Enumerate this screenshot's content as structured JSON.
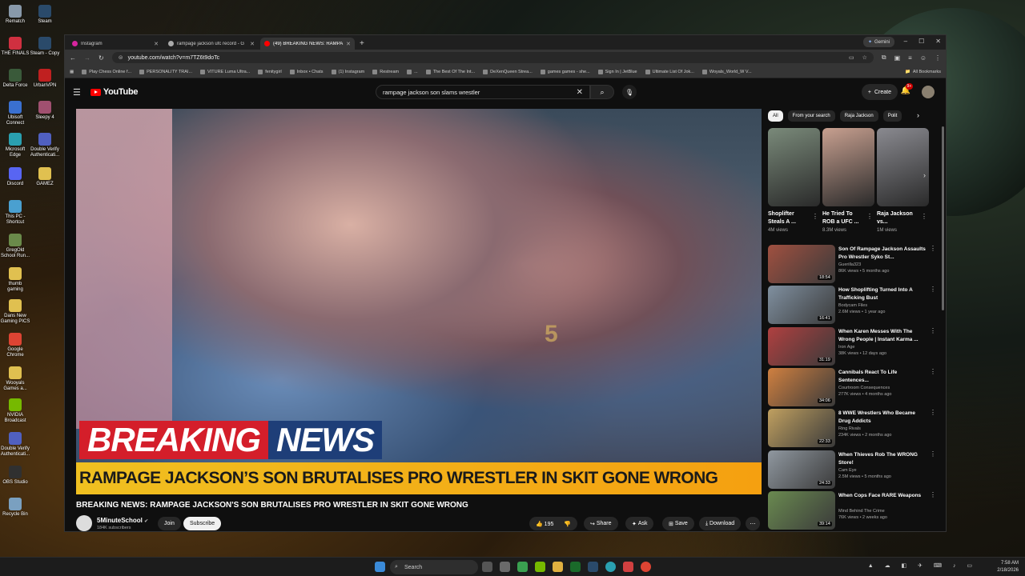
{
  "desktop_icons": [
    {
      "label": "Rematch",
      "color": "#8899aa"
    },
    {
      "label": "Steam",
      "color": "#2a4a6a"
    },
    {
      "label": "THE FINALS",
      "color": "#d03040"
    },
    {
      "label": "Steam - Copy",
      "color": "#2a4a6a"
    },
    {
      "label": "Delta Force",
      "color": "#3a5a3a"
    },
    {
      "label": "UrbanVPN",
      "color": "#c02020"
    },
    {
      "label": "Ubisoft Connect",
      "color": "#3a70d0"
    },
    {
      "label": "Sleepy 4",
      "color": "#a05070"
    },
    {
      "label": "Microsoft Edge",
      "color": "#2aa0b0"
    },
    {
      "label": "Double Verify Authenticati...",
      "color": "#5060c0"
    },
    {
      "label": "Discord",
      "color": "#5865f2"
    },
    {
      "label": "GAMEZ",
      "color": "#e0c050"
    },
    {
      "label": "This PC - Shortcut",
      "color": "#4aa0d0"
    },
    {
      "label": "GregOld School Run...",
      "color": "#6a8a4a"
    },
    {
      "label": "thumb gaming",
      "color": "#e0c050"
    },
    {
      "label": "Dans New Gaming PICS",
      "color": "#e0c050"
    },
    {
      "label": "Google Chrome",
      "color": "#dd4433"
    },
    {
      "label": "Wooyals Games a...",
      "color": "#e0c050"
    },
    {
      "label": "NVIDIA Broadcast",
      "color": "#76b900"
    },
    {
      "label": "Double Verify Authenticati...",
      "color": "#5060c0"
    },
    {
      "label": "OBS Studio",
      "color": "#303030"
    },
    {
      "label": "Recycle Bin",
      "color": "#7aa0c0"
    }
  ],
  "browser": {
    "tabs": [
      {
        "title": "Instagram",
        "color": "#d6249f",
        "active": false
      },
      {
        "title": "rampage jackson ufc record - G",
        "color": "#aaaaaa",
        "active": false
      },
      {
        "title": "(49) BREAKING NEWS: RAMPA",
        "color": "#ff0000",
        "active": true
      }
    ],
    "gemini_label": "Gemini",
    "url": "youtube.com/watch?v=m7TZ6t9doTc",
    "bookmarks": [
      "Play Chess Online f...",
      "PERSONALITY TRAI...",
      "VITURE Luma Ultra...",
      "fenitygirl",
      "Inbox • Chats",
      "(1) Instagram",
      "Restream",
      "...",
      "The Best Of The Int...",
      "DeXenQueen Strea...",
      "games games - she...",
      "Sign In | JetBlue",
      "Ultimate List Of Jok...",
      "Woyals_World_W V..."
    ],
    "all_bookmarks": "All Bookmarks"
  },
  "youtube": {
    "logo_text": "YouTube",
    "search_query": "rampage jackson son slams wrestler",
    "create_label": "Create",
    "notif_count": "9+",
    "video": {
      "breaking_word1": "BREAKING",
      "breaking_word2": "NEWS",
      "ticker": "RAMPAGE JACKSON’S SON BRUTALISES PRO WRESTLER IN SKIT GONE WRONG",
      "title": "BREAKING NEWS: RAMPAGE JACKSON'S SON BRUTALISES PRO WRESTLER IN SKIT GONE WRONG",
      "channel": "5MinuteSchool",
      "subscribers": "184K subscribers",
      "join": "Join",
      "subscribe": "Subscribe",
      "likes": "195",
      "share": "Share",
      "ask": "Ask",
      "save": "Save",
      "download": "Download"
    },
    "chips": [
      "All",
      "From your search",
      "Raja Jackson",
      "Polit"
    ],
    "shorts": [
      {
        "title": "Shoplifter Steals A ...",
        "views": "4M views",
        "color": "#7a8a7a"
      },
      {
        "title": "He Tried To ROB a UFC ...",
        "views": "8.3M views",
        "color": "#c8a090"
      },
      {
        "title": "Raja Jackson vs...",
        "views": "1M views",
        "color": "#8a8a90"
      }
    ],
    "recommendations": [
      {
        "title": "Son Of Rampage Jackson Assaults Pro Wrestler Syko St...",
        "channel": "Guerilla323",
        "meta": "86K views • 5 months ago",
        "duration": "18:54",
        "color": "#a05040"
      },
      {
        "title": "How Shoplifting Turned Into A Trafficking Bust",
        "channel": "Bodycam Files",
        "meta": "2.6M views • 1 year ago",
        "duration": "16:41",
        "color": "#8090a0"
      },
      {
        "title": "When Karen Messes With The Wrong People | Instant Karma ...",
        "channel": "Iron Age",
        "meta": "38K views • 12 days ago",
        "duration": "31:19",
        "color": "#b04040"
      },
      {
        "title": "Cannibals React To Life Sentences...",
        "channel": "Courtroom Consequences",
        "meta": "277K views • 4 months ago",
        "duration": "34:06",
        "color": "#d08040"
      },
      {
        "title": "8 WWE Wrestlers Who Became Drug Addicts",
        "channel": "Ring Rivals",
        "meta": "234K views • 2 months ago",
        "duration": "22:33",
        "color": "#c0a060"
      },
      {
        "title": "When Thieves Rob The WRONG Store!",
        "channel": "Cam Eye",
        "meta": "2.5M views • 5 months ago",
        "duration": "24:33",
        "color": "#9098a0"
      },
      {
        "title": "When Cops Face RARE Weapons",
        "channel": "Mind Behind The Crime",
        "meta": "76K views • 2 weeks ago",
        "duration": "39:14",
        "color": "#6a8a50"
      }
    ]
  },
  "taskbar": {
    "search_label": "Search",
    "time": "7:58 AM",
    "date": "2/18/2026"
  }
}
